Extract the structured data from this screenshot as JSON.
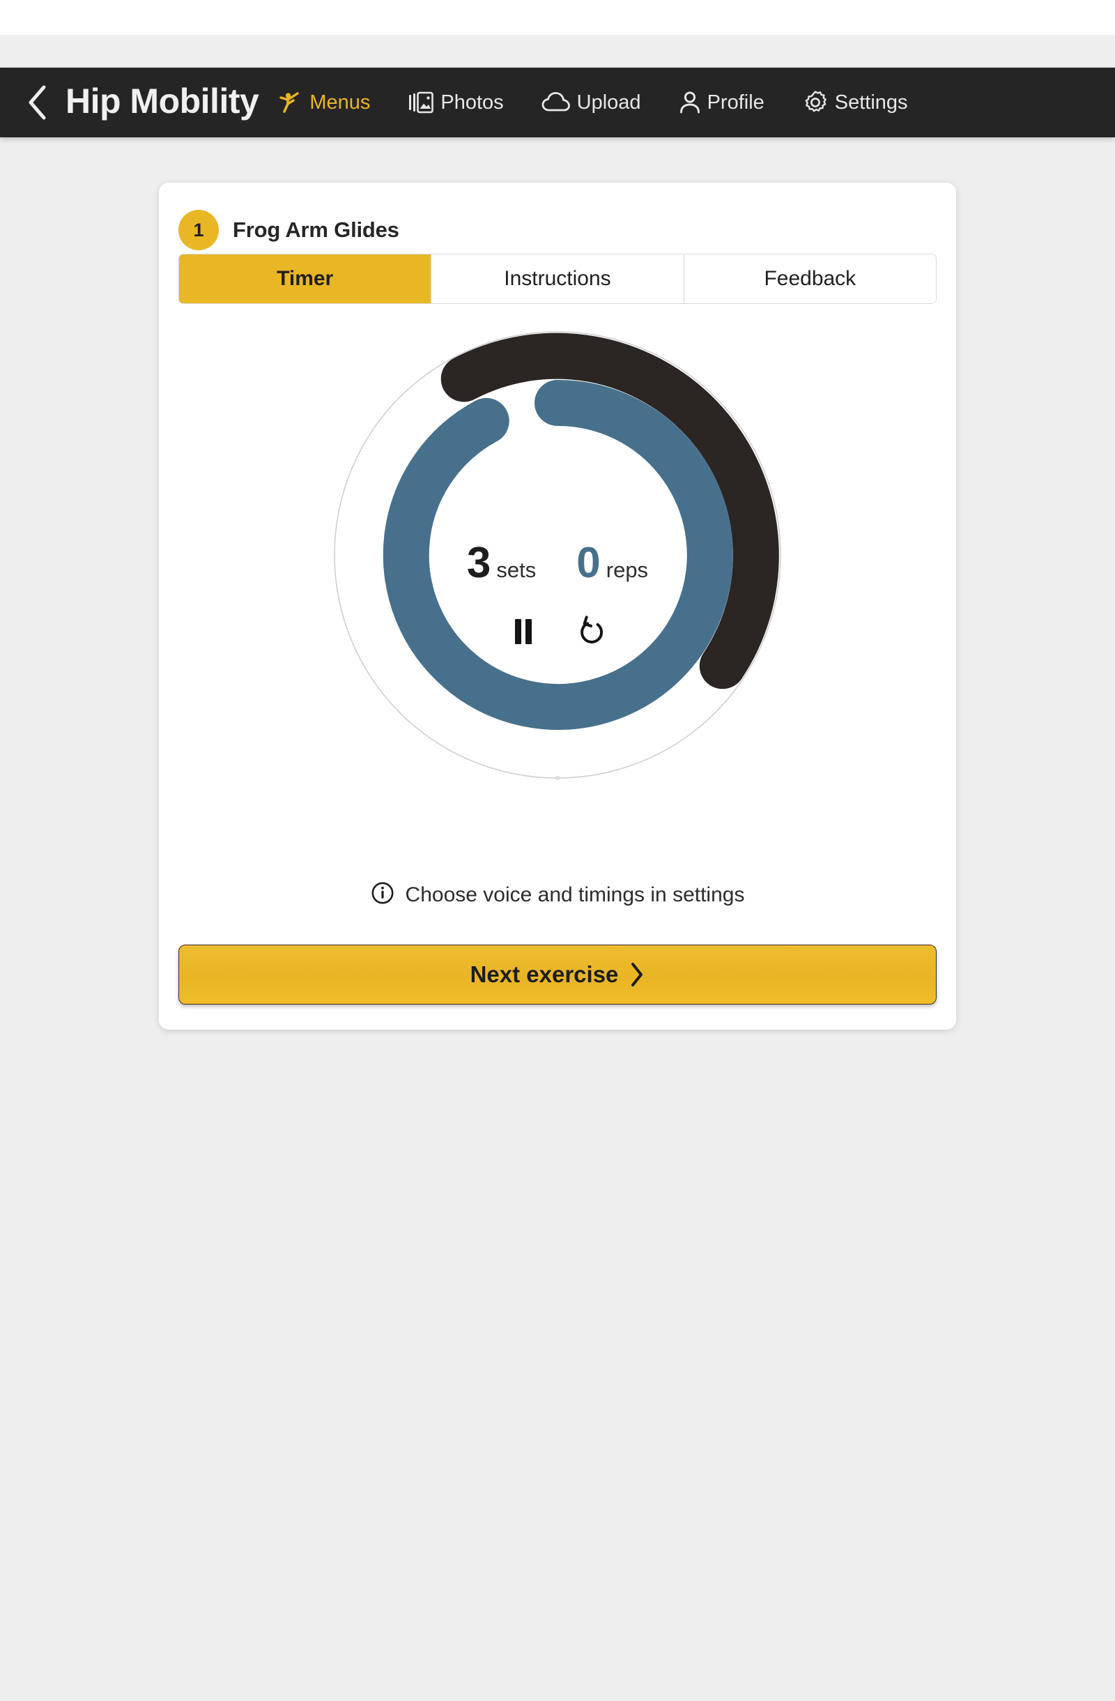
{
  "app": {
    "title": "Hip Mobility",
    "back_icon": "chevron-left-icon"
  },
  "nav": [
    {
      "label": "Menus",
      "icon": "stretching-person-icon",
      "accent": true
    },
    {
      "label": "Photos",
      "icon": "photos-icon",
      "accent": false
    },
    {
      "label": "Upload",
      "icon": "cloud-upload-icon",
      "accent": false
    },
    {
      "label": "Profile",
      "icon": "person-icon",
      "accent": false
    },
    {
      "label": "Settings",
      "icon": "gear-icon",
      "accent": false
    }
  ],
  "card": {
    "step_number": "1",
    "exercise_name": "Frog Arm Glides",
    "tabs": [
      {
        "label": "Timer",
        "active": true
      },
      {
        "label": "Instructions",
        "active": false
      },
      {
        "label": "Feedback",
        "active": false
      }
    ],
    "timer": {
      "sets_value": "3",
      "sets_label": "sets",
      "reps_value": "0",
      "reps_label": "reps",
      "pause_icon": "pause-icon",
      "reset_icon": "restart-icon"
    },
    "info": {
      "icon": "info-icon",
      "text": "Choose voice and timings in settings"
    },
    "next_button": {
      "label": "Next exercise",
      "icon": "chevron-right-icon"
    }
  },
  "colors": {
    "accent_yellow": "#E9B626",
    "header_dark": "#252525",
    "arc_dark": "#2B2523",
    "arc_blue": "#47708C",
    "page_bg": "#EEEEEE",
    "card_bg": "#FFFFFF"
  },
  "chart_data": {
    "type": "pie",
    "title": "Exercise timer progress rings",
    "series": [
      {
        "name": "outer-set-progress",
        "color": "#2B2523",
        "start_angle_deg": 0,
        "sweep_deg": 152,
        "radius": 286,
        "stroke_width": 66,
        "fraction": 0.42
      },
      {
        "name": "inner-rep-progress",
        "color": "#47708C",
        "start_angle_deg": 0,
        "sweep_deg": 332,
        "radius": 218,
        "stroke_width": 66,
        "fraction": 0.92
      },
      {
        "name": "outer-track",
        "color": "#CFCFCF",
        "start_angle_deg": 0,
        "sweep_deg": 360,
        "radius": 320,
        "stroke_width": 1.5,
        "fraction": 1.0
      }
    ]
  }
}
